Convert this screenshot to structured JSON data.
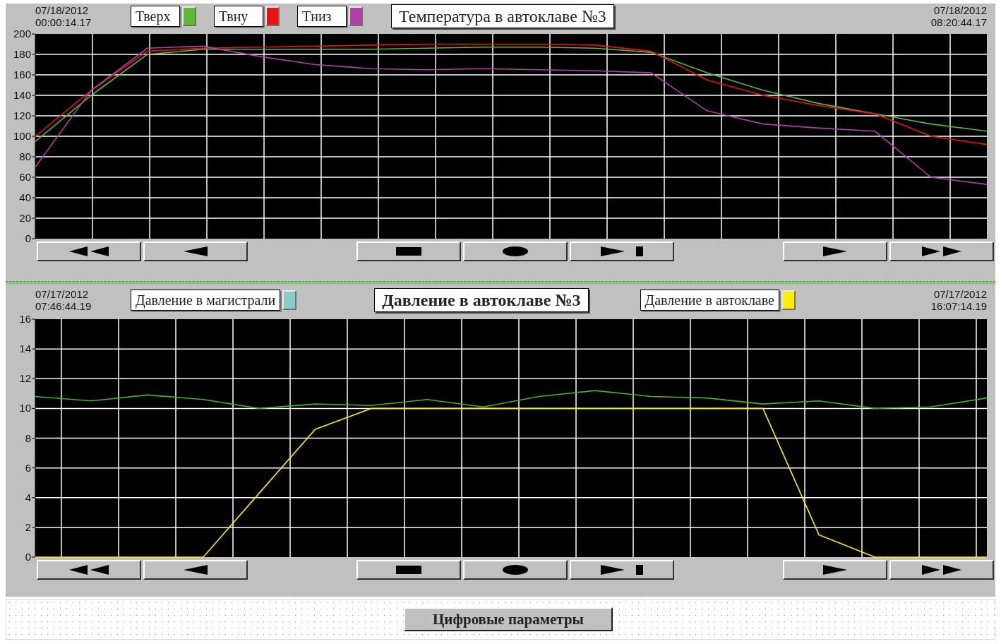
{
  "panels": [
    {
      "header": [
        {
          "kind": "timestamp",
          "date": "07/18/2012",
          "time": "00:00:14.17"
        },
        {
          "kind": "legend",
          "label": "Тверх",
          "color": "#5cb82e"
        },
        {
          "kind": "legend",
          "label": "Твну",
          "color": "#ee1111"
        },
        {
          "kind": "legend",
          "label": "Тниз",
          "color": "#b040a8"
        },
        {
          "kind": "title",
          "text": "Температура в автоклаве №3"
        },
        {
          "kind": "timestamp",
          "date": "07/18/2012",
          "time": "08:20:44.17"
        }
      ],
      "chart_data": {
        "type": "line",
        "grid": true,
        "ylim": [
          0,
          200
        ],
        "yticks": [
          0,
          20,
          40,
          60,
          80,
          100,
          120,
          140,
          160,
          180,
          200
        ],
        "series": [
          {
            "color": "#5cb82e",
            "values": [
              95,
              140,
              180,
              185,
              185,
              185,
              185,
              186,
              187,
              187,
              186,
              182,
              162,
              145,
              132,
              122,
              112,
              105
            ]
          },
          {
            "color": "#ee1111",
            "values": [
              100,
              145,
              183,
              186,
              187,
              188,
              189,
              190,
              190,
              190,
              189,
              183,
              155,
              140,
              130,
              122,
              100,
              92
            ]
          },
          {
            "color": "#b040a8",
            "values": [
              70,
              145,
              186,
              188,
              178,
              170,
              166,
              165,
              166,
              165,
              164,
              162,
              125,
              112,
              108,
              105,
              60,
              53
            ]
          }
        ]
      },
      "button_groups": [
        [
          {
            "kind": "fast_back"
          },
          {
            "kind": "back"
          }
        ],
        [
          {
            "kind": "stop"
          },
          {
            "kind": "hold"
          },
          {
            "kind": "play_end"
          }
        ],
        [
          {
            "kind": "forward"
          },
          {
            "kind": "fast_forward"
          }
        ]
      ]
    },
    {
      "header": [
        {
          "kind": "timestamp",
          "date": "07/17/2012",
          "time": "07:46:44.19"
        },
        {
          "kind": "legend",
          "label": "Давление в магистрали",
          "color": "#88cccc"
        },
        {
          "kind": "title",
          "text": "Давление в автоклаве №3"
        },
        {
          "kind": "legend",
          "label": "Давление в автоклаве",
          "color": "#ffee00"
        },
        {
          "kind": "timestamp",
          "date": "07/17/2012",
          "time": "16:07:14.19"
        }
      ],
      "chart_data": {
        "type": "line",
        "grid": true,
        "ylim": [
          0,
          16
        ],
        "yticks": [
          0,
          2,
          4,
          6,
          8,
          10,
          12,
          14,
          16
        ],
        "series": [
          {
            "color": "#44b030",
            "values": [
              10.8,
              10.5,
              10.9,
              10.6,
              10.0,
              10.3,
              10.2,
              10.6,
              10.1,
              10.8,
              11.2,
              10.8,
              10.7,
              10.3,
              10.5,
              10.0,
              10.1,
              10.7
            ]
          },
          {
            "color": "#ffee00",
            "values": [
              0,
              0,
              0,
              0,
              4.3,
              8.6,
              10,
              10,
              10,
              10,
              10,
              10,
              10,
              10,
              1.5,
              0,
              0,
              0
            ]
          }
        ]
      },
      "button_groups": [
        [
          {
            "kind": "fast_back"
          },
          {
            "kind": "back"
          }
        ],
        [
          {
            "kind": "stop"
          },
          {
            "kind": "hold"
          },
          {
            "kind": "play_end"
          }
        ],
        [
          {
            "kind": "forward"
          },
          {
            "kind": "fast_forward"
          }
        ]
      ]
    }
  ],
  "footer_button": "Цифровые параметры"
}
